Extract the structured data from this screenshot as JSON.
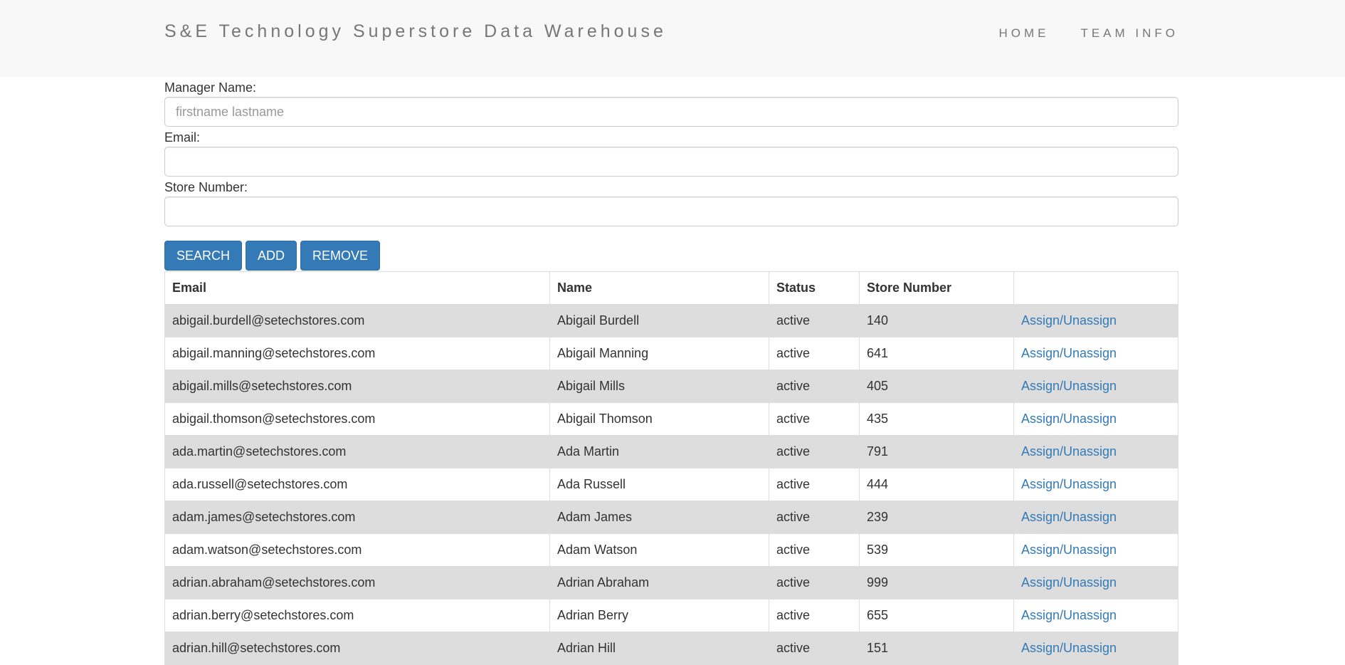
{
  "header": {
    "brand": "S&E Technology Superstore Data Warehouse",
    "nav": [
      "HOME",
      "TEAM INFO"
    ]
  },
  "form": {
    "manager_label": "Manager Name:",
    "manager_placeholder": "firstname lastname",
    "manager_value": "",
    "email_label": "Email:",
    "email_value": "",
    "store_label": "Store Number:",
    "store_value": ""
  },
  "buttons": {
    "search": "SEARCH",
    "add": "ADD",
    "remove": "REMOVE"
  },
  "table": {
    "headers": [
      "Email",
      "Name",
      "Status",
      "Store Number",
      ""
    ],
    "action_label": "Assign/Unassign",
    "rows": [
      {
        "email": "abigail.burdell@setechstores.com",
        "name": "Abigail Burdell",
        "status": "active",
        "store": "140"
      },
      {
        "email": "abigail.manning@setechstores.com",
        "name": "Abigail Manning",
        "status": "active",
        "store": "641"
      },
      {
        "email": "abigail.mills@setechstores.com",
        "name": "Abigail Mills",
        "status": "active",
        "store": "405"
      },
      {
        "email": "abigail.thomson@setechstores.com",
        "name": "Abigail Thomson",
        "status": "active",
        "store": "435"
      },
      {
        "email": "ada.martin@setechstores.com",
        "name": "Ada Martin",
        "status": "active",
        "store": "791"
      },
      {
        "email": "ada.russell@setechstores.com",
        "name": "Ada Russell",
        "status": "active",
        "store": "444"
      },
      {
        "email": "adam.james@setechstores.com",
        "name": "Adam James",
        "status": "active",
        "store": "239"
      },
      {
        "email": "adam.watson@setechstores.com",
        "name": "Adam Watson",
        "status": "active",
        "store": "539"
      },
      {
        "email": "adrian.abraham@setechstores.com",
        "name": "Adrian Abraham",
        "status": "active",
        "store": "999"
      },
      {
        "email": "adrian.berry@setechstores.com",
        "name": "Adrian Berry",
        "status": "active",
        "store": "655"
      },
      {
        "email": "adrian.hill@setechstores.com",
        "name": "Adrian Hill",
        "status": "active",
        "store": "151"
      }
    ]
  },
  "colors": {
    "primary": "#337ab7",
    "navbar_bg": "#f8f8f8",
    "stripe": "#dddddd"
  }
}
